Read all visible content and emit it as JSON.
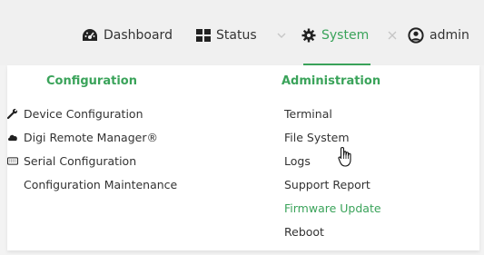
{
  "nav": {
    "dashboard": {
      "label": "Dashboard",
      "icon": "dashboard-gauge-icon"
    },
    "status": {
      "label": "Status",
      "icon": "grid-icon"
    },
    "system": {
      "label": "System",
      "icon": "gear-icon"
    },
    "admin": {
      "label": "admin",
      "icon": "user-circle-icon"
    },
    "accent_color": "#3aa35a"
  },
  "menu": {
    "configuration": {
      "title": "Configuration",
      "items": [
        {
          "label": "Device Configuration",
          "icon": "wrench-icon"
        },
        {
          "label": "Digi Remote Manager®",
          "icon": "cloud-icon"
        },
        {
          "label": "Serial Configuration",
          "icon": "keyboard-icon"
        },
        {
          "label": "Configuration Maintenance",
          "icon": ""
        }
      ]
    },
    "administration": {
      "title": "Administration",
      "items": [
        {
          "label": "Terminal"
        },
        {
          "label": "File System"
        },
        {
          "label": "Logs"
        },
        {
          "label": "Support Report"
        },
        {
          "label": "Firmware Update",
          "hovered": true
        },
        {
          "label": "Reboot"
        }
      ]
    }
  }
}
